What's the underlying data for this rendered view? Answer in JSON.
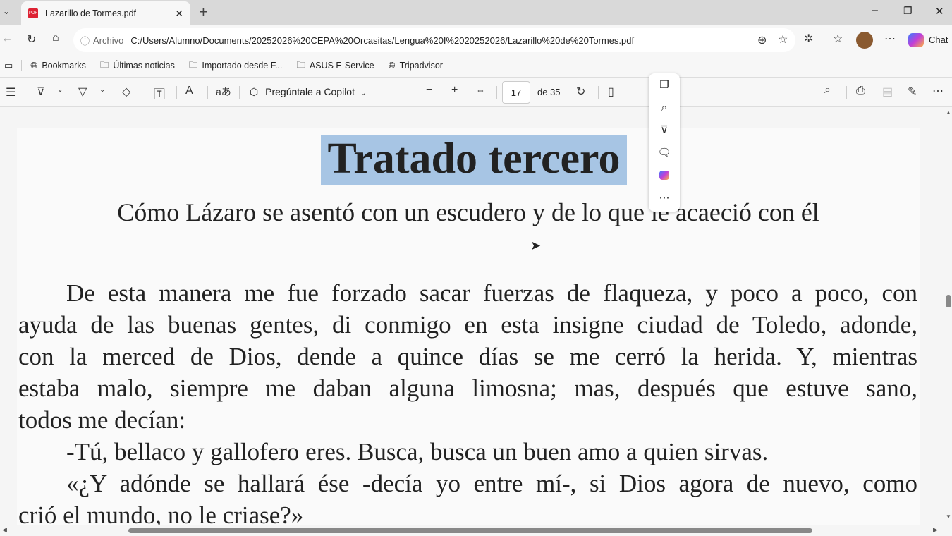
{
  "tab": {
    "title": "Lazarillo de Tormes.pdf"
  },
  "address": {
    "label": "Archivo",
    "url": "C:/Users/Alumno/Documents/20252026%20CEPA%20Orcasitas/Lengua%20I%2020252026/Lazarillo%20de%20Tormes.pdf",
    "chat": "Chat"
  },
  "bookmarks": [
    "Bookmarks",
    "Últimas noticias",
    "Importado desde F...",
    "ASUS E-Service",
    "Tripadvisor"
  ],
  "pdf_toolbar": {
    "copilot": "Pregúntale a Copilot",
    "page": "17",
    "of": "de 35"
  },
  "doc": {
    "title": "Tratado tercero",
    "subtitle": "Cómo Lázaro se asentó con un escudero y de lo que le acaeció con él",
    "lines": [
      "De esta manera me fue forzado sacar fuerzas de flaqueza, y poco a poco, con",
      "ayuda de las buenas gentes, di conmigo en esta insigne ciudad de Toledo, adonde,",
      "con la merced de Dios, dende a quince días se me cerró la herida. Y, mientras",
      "estaba malo, siempre me daban alguna limosna; mas, después que estuve sano,",
      "todos me decían:",
      "-Tú, bellaco y gallofero eres. Busca, busca un buen amo a quien sirvas.",
      "«¿Y adónde se hallará ése -decía yo entre mí-, si Dios agora de nuevo, como",
      "crió el mundo, no le criase?»"
    ]
  }
}
